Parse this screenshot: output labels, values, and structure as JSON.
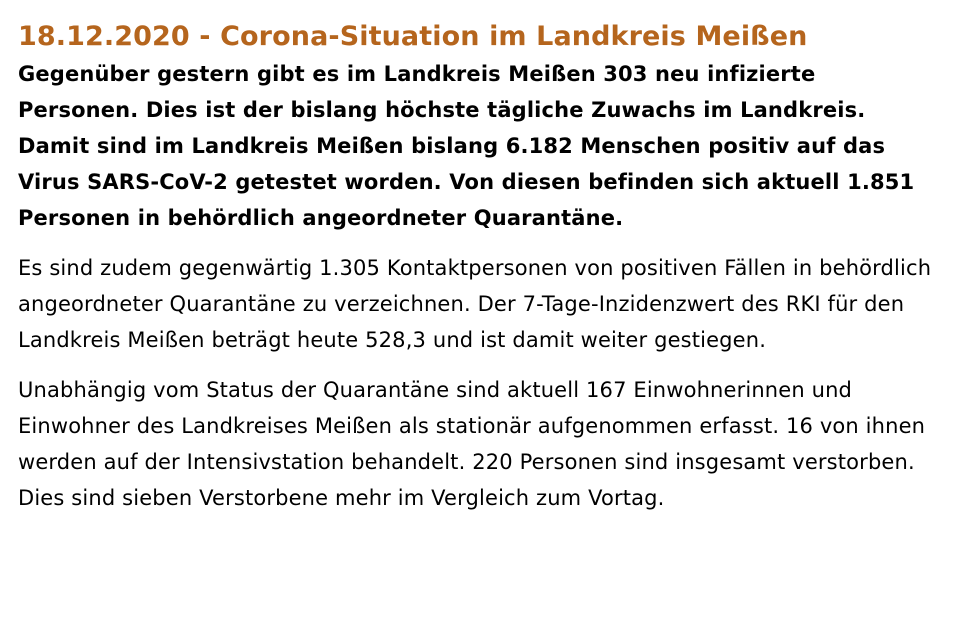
{
  "colors": {
    "headline": "#b5651d",
    "text": "#000000",
    "background": "#ffffff"
  },
  "article": {
    "title": "18.12.2020 - Corona-Situation im Landkreis Meißen",
    "lead": "Gegenüber gestern gibt es im Landkreis Meißen 303 neu infizierte Personen. Dies ist der bislang höchste tägliche Zuwachs im Landkreis. Damit sind im Landkreis Meißen bislang 6.182 Menschen positiv auf das Virus SARS-CoV-2 getestet worden. Von diesen befinden sich aktuell 1.851 Personen in behördlich angeordneter Quarantäne.",
    "paragraphs": [
      "Es sind zudem gegenwärtig 1.305 Kontaktpersonen von positiven Fällen in behördlich angeordneter Quarantäne zu verzeichnen. Der 7-Tage-Inzidenzwert des RKI für den Landkreis Meißen beträgt heute 528,3 und ist damit weiter gestiegen.",
      "Unabhängig vom Status der Quarantäne sind aktuell 167 Einwohnerinnen und Einwohner des Landkreises Meißen als stationär aufgenommen erfasst. 16 von ihnen werden auf der Intensivstation behandelt. 220 Personen sind insgesamt verstorben. Dies sind sieben Verstorbene mehr im Vergleich zum Vortag."
    ]
  }
}
